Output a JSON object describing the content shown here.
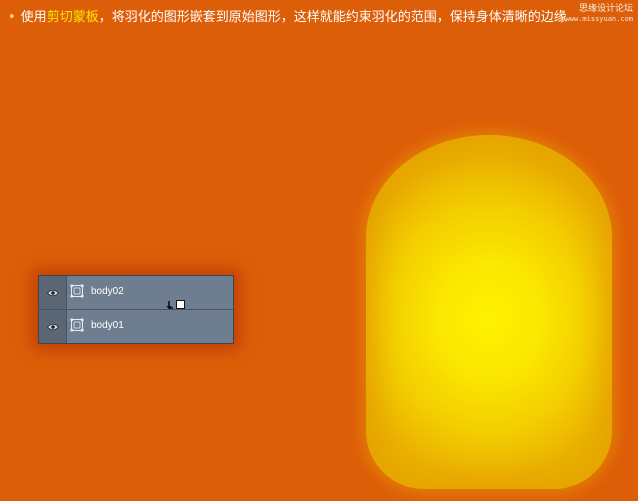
{
  "instruction": {
    "bullet": "•",
    "prefix": "使用",
    "highlight": "剪切蒙板",
    "suffix": "，将羽化的图形嵌套到原始图形，这样就能约束羽化的范围，保持身体清晰的边缘"
  },
  "watermark": {
    "cn": "思缘设计论坛",
    "en": "www.missyuan.com"
  },
  "layers_panel": {
    "layers": [
      {
        "name": "body02",
        "visible": true,
        "clipped": true
      },
      {
        "name": "body01",
        "visible": true,
        "clipped": false
      }
    ],
    "icons": {
      "visibility": "eye-icon",
      "thumbnail": "smart-object-thumbnail-icon",
      "clip": "clipping-mask-cursor-icon"
    }
  },
  "canvas": {
    "shape": "feathered-capsule",
    "colors": {
      "background": "#dd5e08",
      "shape_center": "#fff200",
      "shape_edge": "#e9b000",
      "highlight_text": "#ffe400",
      "panel": "#6e7e90"
    }
  }
}
